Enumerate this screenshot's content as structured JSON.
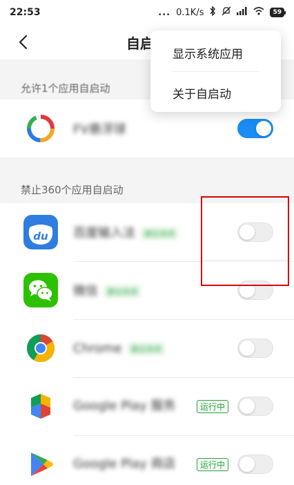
{
  "status_bar": {
    "time": "22:53",
    "dots": "...",
    "network_speed": "0.1K/s",
    "battery": "59",
    "icons": [
      "bluetooth-icon",
      "mute-icon",
      "signal-icon",
      "wifi-icon",
      "battery-icon"
    ]
  },
  "header": {
    "title": "自启动",
    "back_icon": "chevron-left-icon"
  },
  "popup_menu": {
    "items": [
      {
        "label": "显示系统应用"
      },
      {
        "label": "关于自启动"
      }
    ]
  },
  "allowed_section": {
    "label": "允许1个应用自启动",
    "apps": [
      {
        "name": "FV悬浮球",
        "toggle_on": true,
        "icon": "fv-ring-icon"
      }
    ]
  },
  "blocked_section": {
    "label": "禁止360个应用自启动",
    "apps": [
      {
        "name": "百度输入法",
        "tag": "建议关闭",
        "running": "",
        "toggle_on": false,
        "icon": "baidu-du-icon"
      },
      {
        "name": "微信",
        "tag": "建议关闭",
        "running": "",
        "toggle_on": false,
        "icon": "wechat-icon"
      },
      {
        "name": "Chrome",
        "tag": "建议关闭",
        "running": "",
        "toggle_on": false,
        "icon": "chrome-icon"
      },
      {
        "name": "Google Play 服务",
        "tag": "",
        "running": "运行中",
        "toggle_on": false,
        "icon": "play-services-icon"
      },
      {
        "name": "Google Play 商店",
        "tag": "",
        "running": "运行中",
        "toggle_on": false,
        "icon": "play-store-icon"
      }
    ]
  },
  "colors": {
    "accent": "#1a8cf3",
    "running_green": "#2e9e43",
    "highlight_red": "#d90000",
    "background": "#f4f4f4"
  }
}
